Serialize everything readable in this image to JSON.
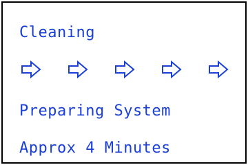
{
  "display": {
    "lines": [
      "Cleaning",
      "Preparing System",
      "Approx 4 Minutes"
    ],
    "progress_arrows": {
      "count": 5,
      "icon": "right-arrow-outline-icon"
    },
    "text_color": "#1a3fd6",
    "border_color": "#000000",
    "background_color": "#ffffff"
  }
}
